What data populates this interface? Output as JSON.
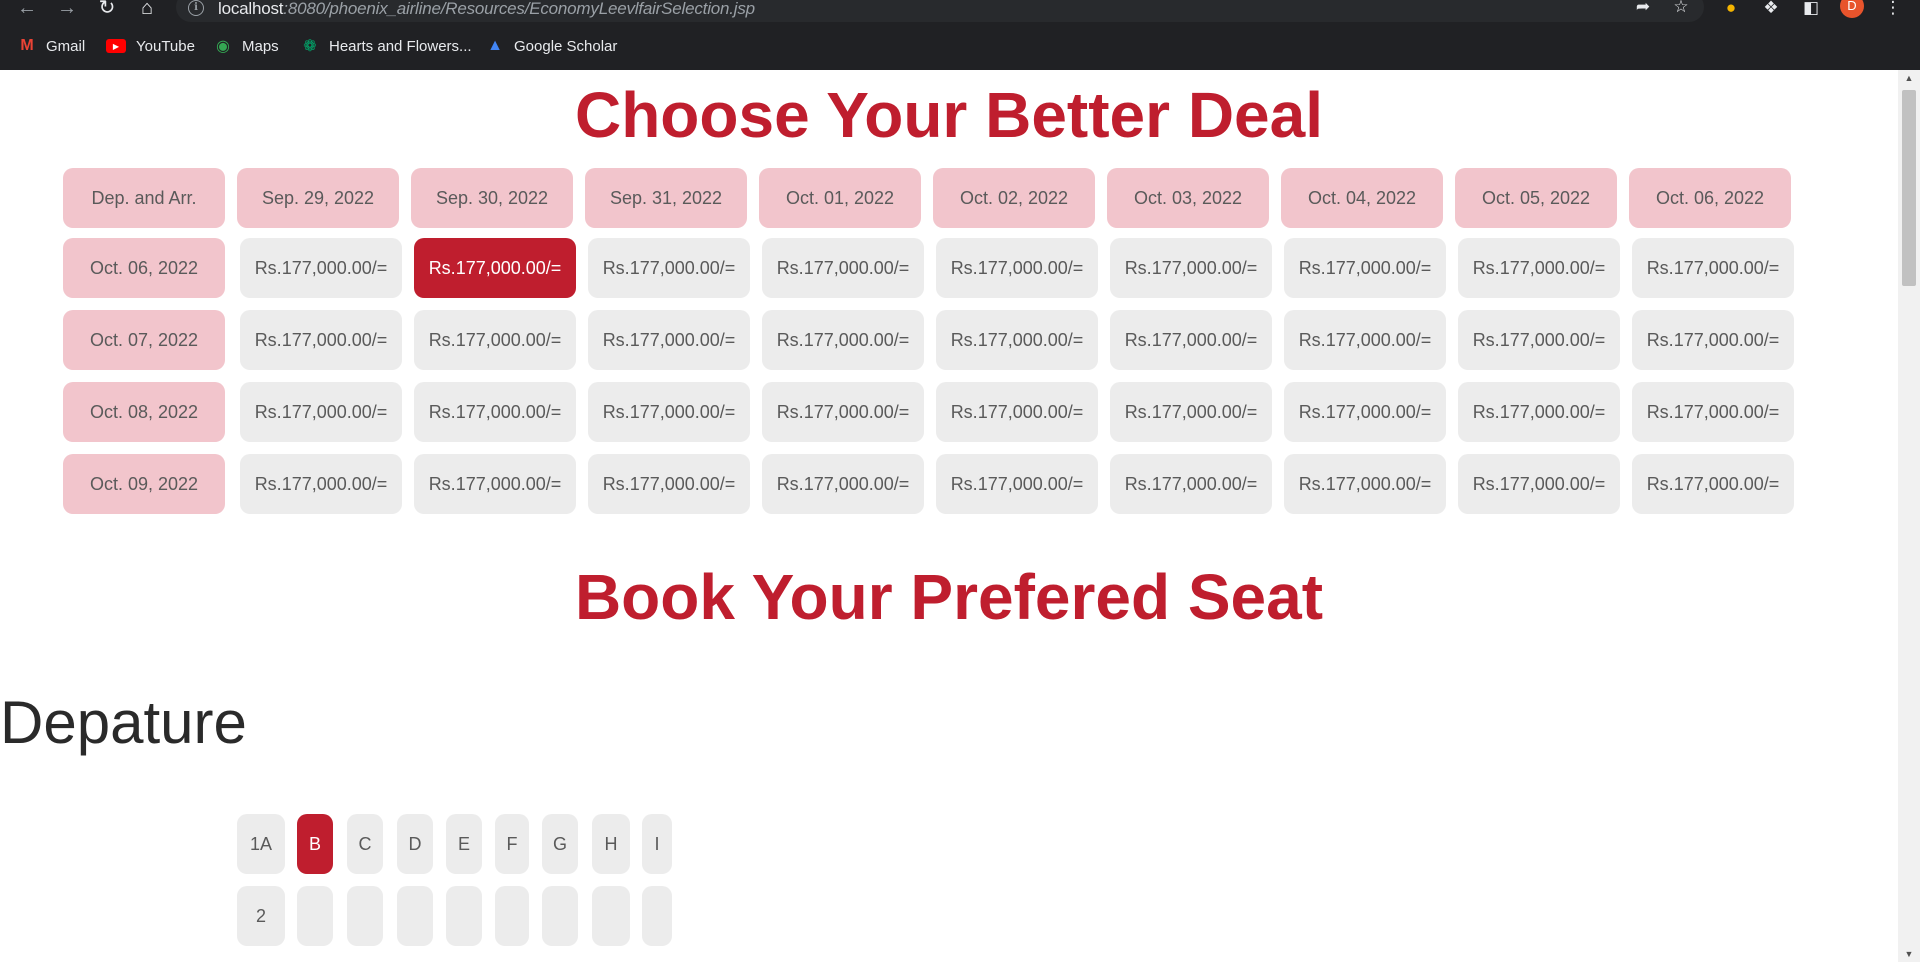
{
  "browser": {
    "url_host": "localhost",
    "url_rest": ":8080/phoenix_airline/Resources/EconomyLeevlfairSelection.jsp",
    "profile_initial": "D",
    "nav_icons": [
      "back-icon",
      "forward-icon",
      "reload-icon",
      "home-icon"
    ],
    "bookmarks": [
      {
        "label": "Gmail",
        "icon": "gmail-icon",
        "color": "#ea4335"
      },
      {
        "label": "YouTube",
        "icon": "youtube-icon",
        "color": "#ff0000"
      },
      {
        "label": "Maps",
        "icon": "maps-icon",
        "color": "#34a853"
      },
      {
        "label": "Hearts and Flowers...",
        "icon": "palm-icon",
        "color": "#00a86b"
      },
      {
        "label": "Google Scholar",
        "icon": "scholar-icon",
        "color": "#4285f4"
      }
    ]
  },
  "deal": {
    "title": "Choose Your Better Deal",
    "header_corner": "Dep. and Arr.",
    "columns": [
      "Sep. 29, 2022",
      "Sep. 30, 2022",
      "Sep. 31, 2022",
      "Oct. 01, 2022",
      "Oct. 02, 2022",
      "Oct. 03, 2022",
      "Oct. 04, 2022",
      "Oct. 05, 2022",
      "Oct. 06, 2022"
    ],
    "rows": [
      {
        "date": "Oct. 06, 2022",
        "prices": [
          "Rs.177,000.00/=",
          "Rs.177,000.00/=",
          "Rs.177,000.00/=",
          "Rs.177,000.00/=",
          "Rs.177,000.00/=",
          "Rs.177,000.00/=",
          "Rs.177,000.00/=",
          "Rs.177,000.00/=",
          "Rs.177,000.00/="
        ]
      },
      {
        "date": "Oct. 07, 2022",
        "prices": [
          "Rs.177,000.00/=",
          "Rs.177,000.00/=",
          "Rs.177,000.00/=",
          "Rs.177,000.00/=",
          "Rs.177,000.00/=",
          "Rs.177,000.00/=",
          "Rs.177,000.00/=",
          "Rs.177,000.00/=",
          "Rs.177,000.00/="
        ]
      },
      {
        "date": "Oct. 08, 2022",
        "prices": [
          "Rs.177,000.00/=",
          "Rs.177,000.00/=",
          "Rs.177,000.00/=",
          "Rs.177,000.00/=",
          "Rs.177,000.00/=",
          "Rs.177,000.00/=",
          "Rs.177,000.00/=",
          "Rs.177,000.00/=",
          "Rs.177,000.00/="
        ]
      },
      {
        "date": "Oct. 09, 2022",
        "prices": [
          "Rs.177,000.00/=",
          "Rs.177,000.00/=",
          "Rs.177,000.00/=",
          "Rs.177,000.00/=",
          "Rs.177,000.00/=",
          "Rs.177,000.00/=",
          "Rs.177,000.00/=",
          "Rs.177,000.00/=",
          "Rs.177,000.00/="
        ]
      }
    ],
    "selected": {
      "row": 0,
      "col": 1
    },
    "accent_color": "#bf1e2e",
    "header_color": "#f2c5cc",
    "cell_color": "#ececec"
  },
  "seats": {
    "title": "Book Your Prefered Seat",
    "section": "Depature",
    "row1": [
      "1A",
      "B",
      "C",
      "D",
      "E",
      "F",
      "G",
      "H",
      "I"
    ],
    "row2": [
      "2",
      "",
      "",
      "",
      "",
      "",
      "",
      "",
      ""
    ],
    "selected_index": 1
  }
}
